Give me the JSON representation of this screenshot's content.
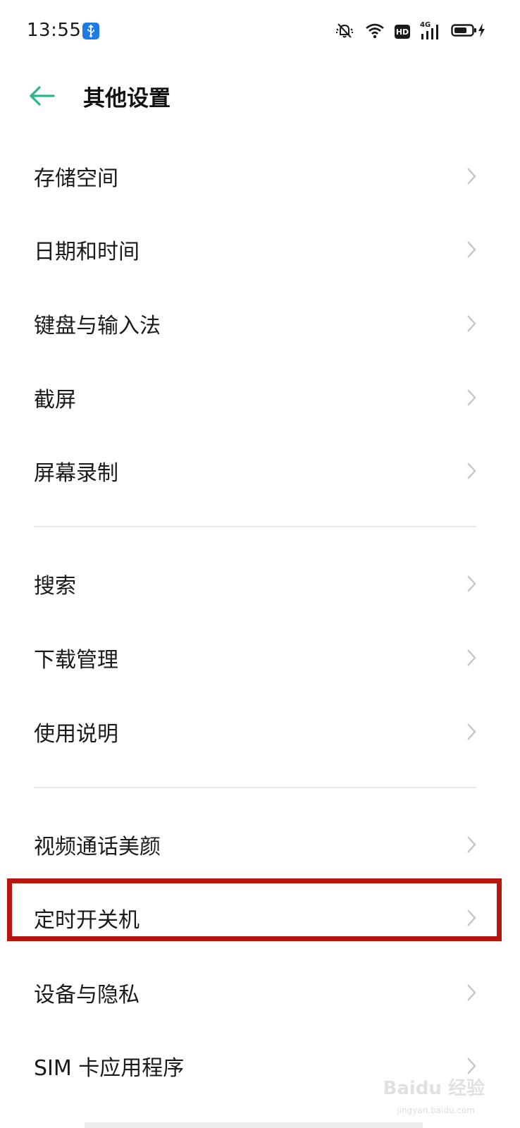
{
  "status_bar": {
    "time": "13:55",
    "hd_label": "HD",
    "network_label": "4G"
  },
  "header": {
    "title": "其他设置"
  },
  "items": [
    {
      "label": "存储空间"
    },
    {
      "label": "日期和时间"
    },
    {
      "label": "键盘与输入法"
    },
    {
      "label": "截屏"
    },
    {
      "label": "屏幕录制"
    },
    {
      "label": "搜索"
    },
    {
      "label": "下载管理"
    },
    {
      "label": "使用说明"
    },
    {
      "label": "视频通话美颜"
    },
    {
      "label": "定时开关机"
    },
    {
      "label": "设备与隐私"
    },
    {
      "label": "SIM 卡应用程序"
    }
  ],
  "highlighted_item": "定时开关机",
  "watermark": {
    "text": "Baidu 经验",
    "sub": "jingyan.baidu.com"
  },
  "colors": {
    "accent": "#2db38b",
    "highlight_border": "#b8150e",
    "usb_badge": "#1e7be6",
    "divider": "#e7e7e7",
    "chevron": "#c4c4c4"
  },
  "icons": {
    "back": "arrow-left-icon",
    "usb": "usb-icon",
    "silent": "bell-off-icon",
    "wifi": "wifi-icon",
    "hd": "hd-icon",
    "signal": "cell-signal-icon",
    "battery": "battery-charging-icon",
    "chevron": "chevron-right-icon"
  }
}
